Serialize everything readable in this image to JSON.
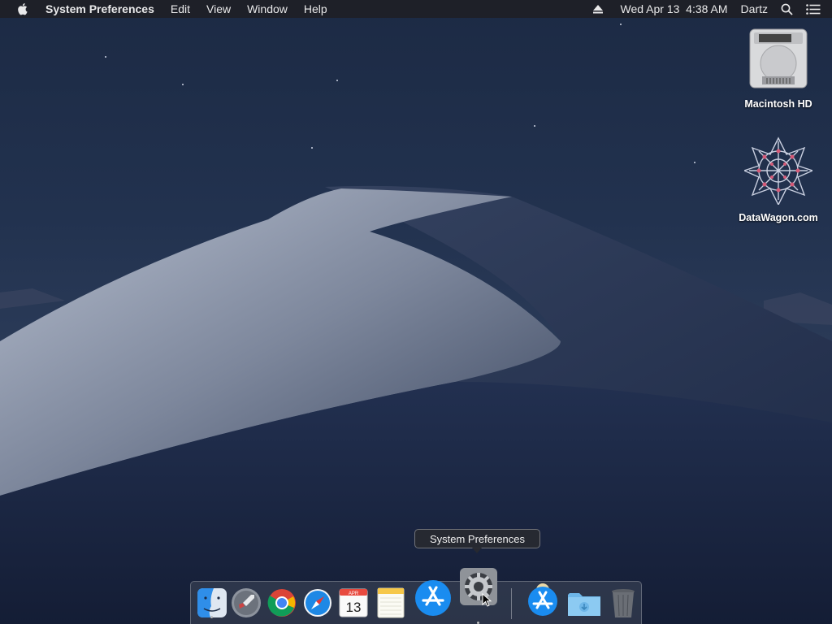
{
  "menubar": {
    "app_name": "System Preferences",
    "menus": [
      "Edit",
      "View",
      "Window",
      "Help"
    ],
    "clock": "Wed Apr 13  4:38 AM",
    "user": "Dartz",
    "icons": [
      "apple-icon",
      "eject-icon",
      "spotlight-search-icon",
      "notification-center-icon"
    ]
  },
  "desktop": {
    "icons": [
      {
        "label": "Macintosh HD",
        "icon": "hard-drive-icon"
      },
      {
        "label": "DataWagon.com",
        "icon": "datawagon-logo-icon"
      }
    ]
  },
  "tooltip": {
    "text": "System Preferences"
  },
  "dock": {
    "items": [
      {
        "name": "Finder",
        "icon": "finder-icon",
        "running": true
      },
      {
        "name": "Launchpad",
        "icon": "launchpad-icon",
        "running": false
      },
      {
        "name": "Google Chrome",
        "icon": "chrome-icon",
        "running": false
      },
      {
        "name": "Safari",
        "icon": "safari-icon",
        "running": false
      },
      {
        "name": "Calendar",
        "icon": "calendar-icon",
        "running": false,
        "month": "APR",
        "day": "13"
      },
      {
        "name": "Notes",
        "icon": "notes-icon",
        "running": false
      },
      {
        "name": "App Store",
        "icon": "app-store-icon",
        "running": false
      },
      {
        "name": "System Preferences",
        "icon": "system-preferences-icon",
        "running": true
      },
      {
        "name": "App Store Downloads",
        "icon": "app-store-download-icon",
        "running": false
      },
      {
        "name": "Downloads",
        "icon": "downloads-folder-icon",
        "running": false
      },
      {
        "name": "Trash",
        "icon": "trash-icon",
        "running": false
      }
    ]
  },
  "colors": {
    "menubar_bg": "#1e2026",
    "desktop_bg": "#22324f",
    "dune": "#8a93a8"
  }
}
